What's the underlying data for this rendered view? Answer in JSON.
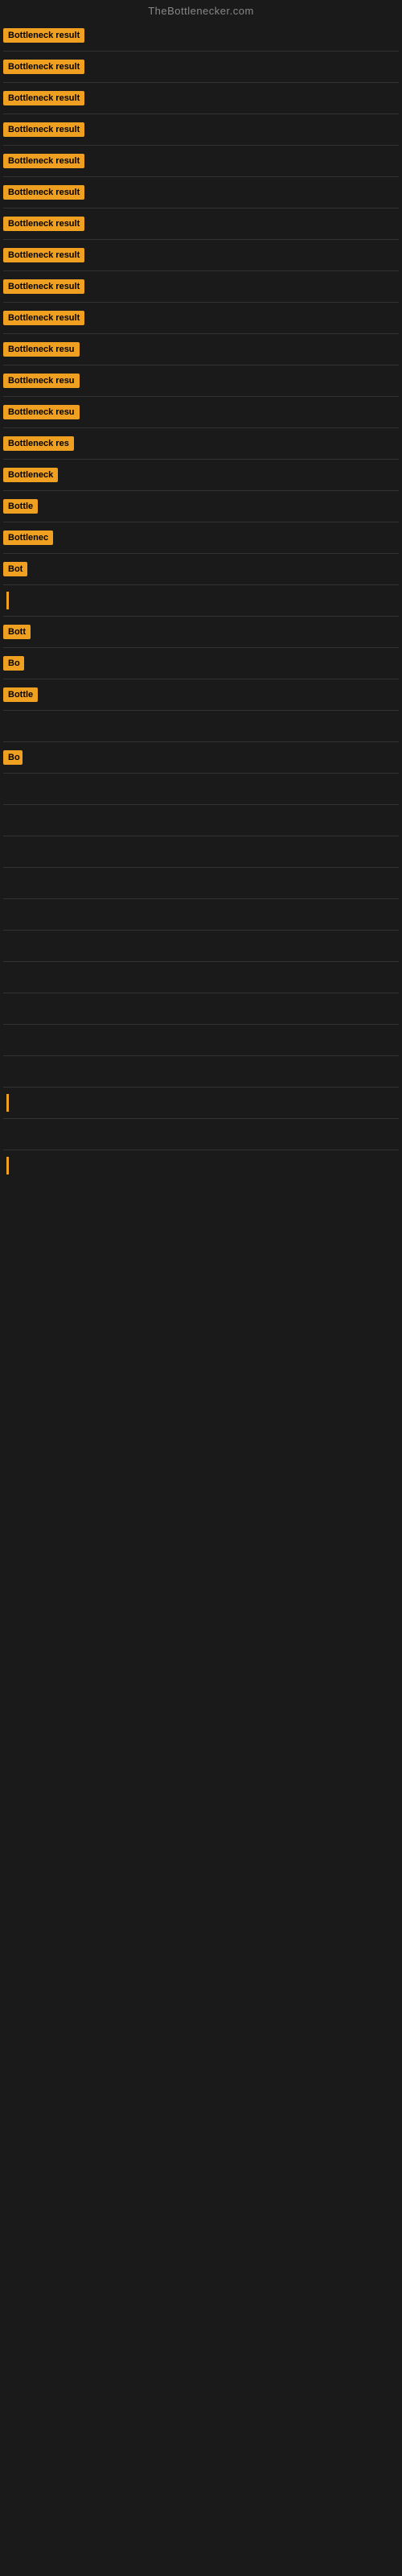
{
  "site": {
    "title": "TheBottlenecker.com"
  },
  "rows": [
    {
      "label": "Bottleneck result",
      "width": 120
    },
    {
      "label": "Bottleneck result",
      "width": 120
    },
    {
      "label": "Bottleneck result",
      "width": 120
    },
    {
      "label": "Bottleneck result",
      "width": 120
    },
    {
      "label": "Bottleneck result",
      "width": 120
    },
    {
      "label": "Bottleneck result",
      "width": 120
    },
    {
      "label": "Bottleneck result",
      "width": 120
    },
    {
      "label": "Bottleneck result",
      "width": 120
    },
    {
      "label": "Bottleneck result",
      "width": 120
    },
    {
      "label": "Bottleneck result",
      "width": 120
    },
    {
      "label": "Bottleneck resu",
      "width": 100
    },
    {
      "label": "Bottleneck resu",
      "width": 100
    },
    {
      "label": "Bottleneck resu",
      "width": 100
    },
    {
      "label": "Bottleneck res",
      "width": 90
    },
    {
      "label": "Bottleneck",
      "width": 72
    },
    {
      "label": "Bottle",
      "width": 52
    },
    {
      "label": "Bottlenec",
      "width": 66
    },
    {
      "label": "Bot",
      "width": 34
    },
    {
      "label": "|",
      "width": 8
    },
    {
      "label": "Bott",
      "width": 38
    },
    {
      "label": "Bo",
      "width": 26
    },
    {
      "label": "Bottle",
      "width": 48
    },
    {
      "label": "",
      "width": 0
    },
    {
      "label": "Bo",
      "width": 24
    },
    {
      "label": "",
      "width": 0
    },
    {
      "label": "",
      "width": 0
    },
    {
      "label": "",
      "width": 0
    },
    {
      "label": "",
      "width": 0
    },
    {
      "label": "",
      "width": 0
    },
    {
      "label": "",
      "width": 0
    },
    {
      "label": "",
      "width": 0
    },
    {
      "label": "",
      "width": 0
    },
    {
      "label": "",
      "width": 0
    },
    {
      "label": "",
      "width": 0
    },
    {
      "label": "|",
      "width": 8
    },
    {
      "label": "",
      "width": 0
    },
    {
      "label": "|",
      "width": 8
    }
  ]
}
